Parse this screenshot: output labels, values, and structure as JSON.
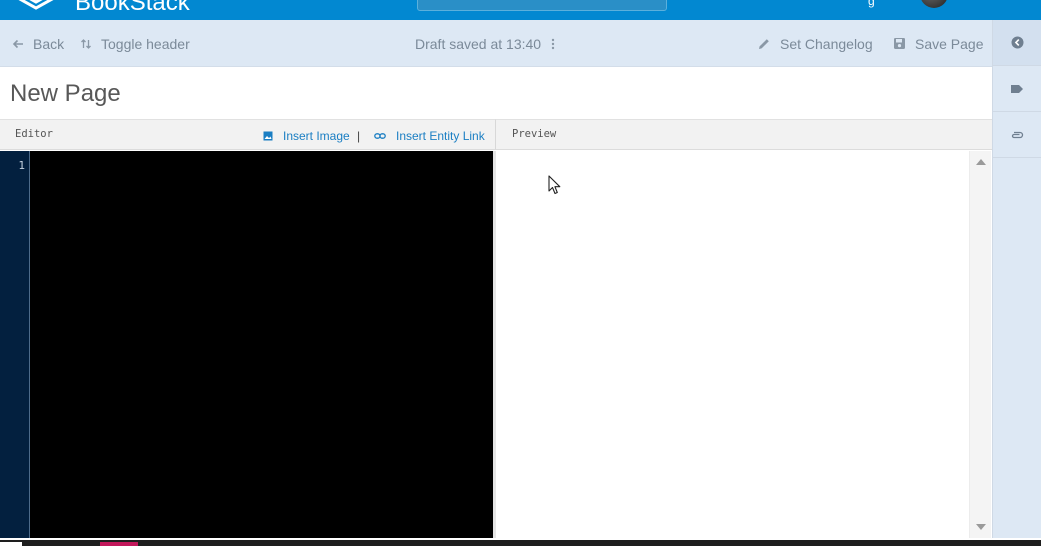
{
  "app": {
    "brand_name": "BookStack"
  },
  "toolbar": {
    "back_label": "Back",
    "toggle_header_label": "Toggle header",
    "draft_status": "Draft saved at 13:40",
    "set_changelog_label": "Set Changelog",
    "save_page_label": "Save Page"
  },
  "page": {
    "title": "New Page"
  },
  "editor": {
    "header_label": "Editor",
    "insert_image_label": "Insert Image",
    "separator": "|",
    "insert_entity_link_label": "Insert Entity Link",
    "line_number": "1"
  },
  "preview": {
    "header_label": "Preview"
  },
  "colors": {
    "header_blue": "#0288d1",
    "toolbar_bg": "#dde8f4",
    "link_blue": "#1a7ec3",
    "gutter_bg": "#03203f",
    "code_bg": "#000000"
  },
  "icons": {
    "back": "arrow-left-icon",
    "toggle": "swap-vertical-icon",
    "draft_menu": "more-vertical-icon",
    "changelog": "pencil-icon",
    "save": "floppy-disk-icon",
    "insert_image": "image-icon",
    "insert_link": "link-icon",
    "sidebar_1": "chevron-left-circle-icon",
    "sidebar_2": "tag-icon",
    "sidebar_3": "paperclip-icon"
  }
}
